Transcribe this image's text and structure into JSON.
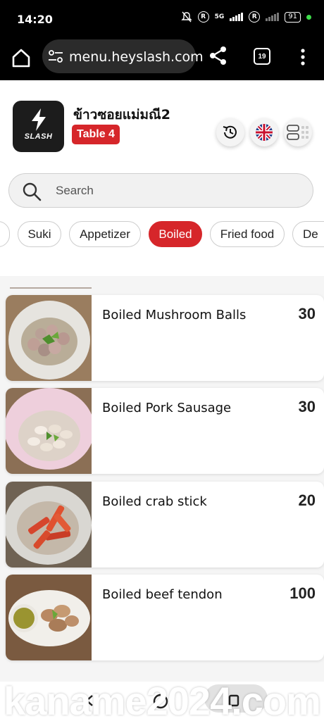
{
  "status_bar": {
    "time": "14:20",
    "network": "5G",
    "battery": "91",
    "icons": [
      "bell-off-icon",
      "r-icon",
      "signal-icon",
      "r-icon",
      "signal-weak-icon",
      "battery-icon",
      "dot-icon"
    ]
  },
  "browser": {
    "url": "menu.heyslash.com",
    "tab_count": "19",
    "icons": [
      "home-icon",
      "tune-icon",
      "share-icon",
      "tabs-icon",
      "more-vert-icon"
    ]
  },
  "restaurant": {
    "logo_text": "SLASH",
    "name": "ข้าวซอยแม่มณี2",
    "table": "Table 4",
    "icons": [
      "history-icon",
      "uk-flag-icon",
      "view-toggle-icon"
    ]
  },
  "search": {
    "placeholder": "Search"
  },
  "categories": [
    {
      "label": "",
      "active": false
    },
    {
      "label": "Suki",
      "active": false
    },
    {
      "label": "Appetizer",
      "active": false
    },
    {
      "label": "Boiled",
      "active": true
    },
    {
      "label": "Fried food",
      "active": false
    },
    {
      "label": "De",
      "active": false
    }
  ],
  "menu_items": [
    {
      "name": "Boiled Mushroom Balls",
      "price": "30",
      "photo": "mushroom-balls-photo"
    },
    {
      "name": "Boiled Pork Sausage",
      "price": "30",
      "photo": "pork-sausage-photo"
    },
    {
      "name": "Boiled crab stick",
      "price": "20",
      "photo": "crab-stick-photo"
    },
    {
      "name": "Boiled beef tendon",
      "price": "100",
      "photo": "beef-tendon-photo"
    }
  ],
  "watermark": "kaname2024.com",
  "colors": {
    "accent_red": "#d6262a",
    "status_bar": "#000000",
    "list_background": "#f5f5f5"
  }
}
